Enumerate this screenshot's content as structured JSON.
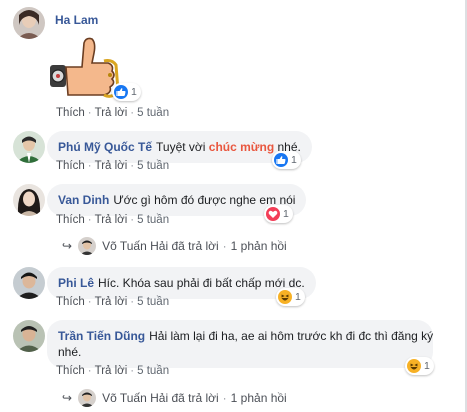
{
  "comments": [
    {
      "name": "Ha Lam",
      "sticker": "thumbs-up-sticker",
      "reaction": {
        "icon": "like-icon",
        "count": "1"
      },
      "actions": {
        "like": "Thích",
        "reply": "Trả lời",
        "time": "5 tuần"
      }
    },
    {
      "name": "Phú Mỹ Quốc Tế",
      "text_before": "Tuyệt vời ",
      "text_highlight": "chúc mừng",
      "text_after": " nhé.",
      "reaction": {
        "icon": "like-icon",
        "count": "1"
      },
      "actions": {
        "like": "Thích",
        "reply": "Trả lời",
        "time": "5 tuần"
      }
    },
    {
      "name": "Van Dinh",
      "text": "Ước gì hôm đó được nghe em nói",
      "reaction": {
        "icon": "love-icon",
        "count": "1"
      },
      "actions": {
        "like": "Thích",
        "reply": "Trả lời",
        "time": "5 tuần"
      },
      "reply_summary": {
        "text": "Võ Tuấn Hải đã trả lời",
        "count": "1 phản hồi"
      }
    },
    {
      "name": "Phi Lê",
      "text": "Híc. Khóa sau phải đi bất chấp mới dc.",
      "reaction": {
        "icon": "haha-icon",
        "count": "1"
      },
      "actions": {
        "like": "Thích",
        "reply": "Trả lời",
        "time": "5 tuần"
      }
    },
    {
      "name": "Trần Tiến Dũng",
      "text_line1": "Hải làm lại đi ha, ae ai hôm trước kh đi đc thì đăng ký",
      "text_line2": "nhé.",
      "reaction": {
        "icon": "haha-icon",
        "count": "1"
      },
      "actions": {
        "like": "Thích",
        "reply": "Trả lời",
        "time": "5 tuần"
      },
      "reply_summary": {
        "text": "Võ Tuấn Hải đã trả lời",
        "count": "1 phản hồi"
      }
    }
  ],
  "colors": {
    "name": "#385898",
    "highlight": "#e9573f",
    "bubble": "#f2f3f5",
    "like": "#1877f2",
    "love": "#f33e58",
    "haha": "#f7b125"
  }
}
